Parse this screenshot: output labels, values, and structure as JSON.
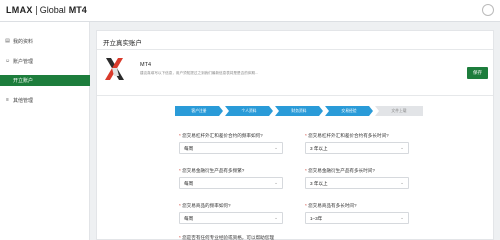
{
  "brand": {
    "part1": "LMAX",
    "part2": "Global",
    "part3": "MT4"
  },
  "sidebar": {
    "items": [
      {
        "icon": "doc-icon",
        "label": "我的资料"
      },
      {
        "icon": "user-icon",
        "label": "账户管理"
      },
      {
        "label": "开立账户",
        "active": true
      },
      {
        "icon": "menu-icon",
        "label": "其他管理"
      }
    ]
  },
  "main": {
    "title": "开立真实账户",
    "account": {
      "name": "MT4",
      "desc": "建议真填写以下信息，用户须知提过之到我们最新信息表将是是否的体期..."
    },
    "save_label": "保存"
  },
  "steps": [
    {
      "label": "客户注册",
      "state": "done"
    },
    {
      "label": "个人资料",
      "state": "done"
    },
    {
      "label": "财务资料",
      "state": "done"
    },
    {
      "label": "交易经验",
      "state": "current"
    },
    {
      "label": "文件上载",
      "state": "todo"
    }
  ],
  "form": {
    "q1": {
      "label": "您交易杠杆外汇和差价合约的频率如何?",
      "value": "每周"
    },
    "q2": {
      "label": "您交易杠杆外汇和差价合约有多长时间?",
      "value": "3 年以上"
    },
    "q3": {
      "label": "您交易金融衍生产品有多频繁?",
      "value": "每周"
    },
    "q4": {
      "label": "您交易金融衍生产品有多长时间?",
      "value": "3 年以上"
    },
    "q5": {
      "label": "您交易商品的频率如何?",
      "value": "每周"
    },
    "q6": {
      "label": "您交易商品有多长时间?",
      "value": "1–3年"
    },
    "q7": {
      "label": "您是否有任何专业经验或资格，可以帮助您理"
    }
  },
  "colors": {
    "brand_green": "#1d7d3c",
    "step_blue": "#2a9bd8",
    "required_red": "#d03a2b"
  }
}
